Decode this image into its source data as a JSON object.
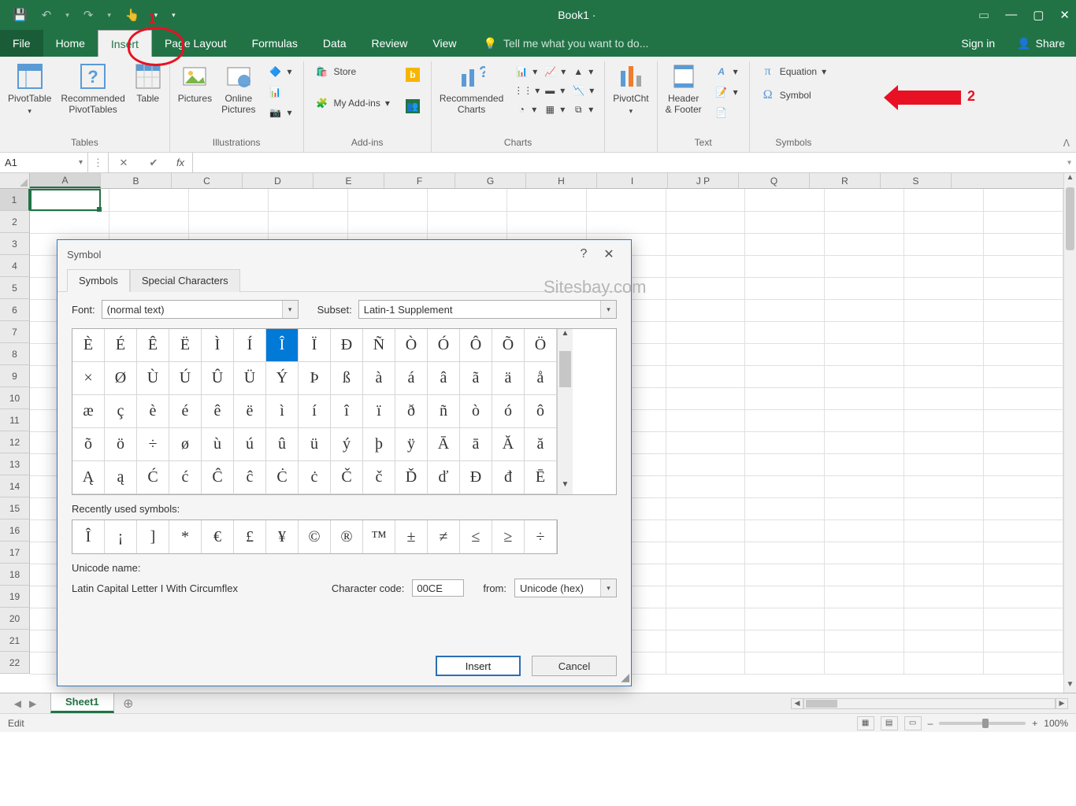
{
  "titlebar": {
    "file": "Book1 · "
  },
  "tabs": [
    "File",
    "Home",
    "Insert",
    "Page Layout",
    "Formulas",
    "Data",
    "Review",
    "View"
  ],
  "active_tab": "Insert",
  "tellme": "Tell me what you want to do...",
  "signin": "Sign in",
  "share": "Share",
  "ribbon": {
    "tables": {
      "label": "Tables",
      "pivot": "PivotTable",
      "rec": "Recommended\nPivotTables",
      "table": "Table"
    },
    "illus": {
      "label": "Illustrations",
      "pics": "Pictures",
      "online": "Online\nPictures"
    },
    "addins": {
      "label": "Add-ins",
      "store": "Store",
      "my": "My Add-ins"
    },
    "reccharts": {
      "label": "Recommended\nCharts"
    },
    "charts_group": "Charts",
    "pivotcht": "PivotCht",
    "text": {
      "label": "Text",
      "hf": "Header\n& Footer"
    },
    "symbols": {
      "label": "Symbols",
      "eq": "Equation",
      "sym": "Symbol"
    }
  },
  "formula_bar": {
    "name": "A1",
    "fx": "fx"
  },
  "columns": [
    "A",
    "B",
    "C",
    "D",
    "E",
    "F",
    "G",
    "H",
    "I",
    "J P",
    "Q",
    "R",
    "S"
  ],
  "rows": [
    "1",
    "2",
    "3",
    "4",
    "5",
    "6",
    "7",
    "8",
    "9",
    "10",
    "11",
    "12",
    "13",
    "14",
    "15",
    "16",
    "17",
    "18",
    "19",
    "20",
    "21",
    "22"
  ],
  "sheettab": "Sheet1",
  "status": "Edit",
  "zoom": "100%",
  "watermark": "Sitesbay.com",
  "annotations": {
    "a1": "1",
    "a2": "2"
  },
  "dialog": {
    "title": "Symbol",
    "tabs": [
      "Symbols",
      "Special Characters"
    ],
    "font_label": "Font:",
    "font": "(normal text)",
    "subset_label": "Subset:",
    "subset": "Latin-1 Supplement",
    "grid": [
      [
        "È",
        "É",
        "Ê",
        "Ë",
        "Ì",
        "Í",
        "Î",
        "Ï",
        "Ð",
        "Ñ",
        "Ò",
        "Ó",
        "Ô",
        "Õ",
        "Ö"
      ],
      [
        "×",
        "Ø",
        "Ù",
        "Ú",
        "Û",
        "Ü",
        "Ý",
        "Þ",
        "ß",
        "à",
        "á",
        "â",
        "ã",
        "ä",
        "å"
      ],
      [
        "æ",
        "ç",
        "è",
        "é",
        "ê",
        "ë",
        "ì",
        "í",
        "î",
        "ï",
        "ð",
        "ñ",
        "ò",
        "ó",
        "ô"
      ],
      [
        "õ",
        "ö",
        "÷",
        "ø",
        "ù",
        "ú",
        "û",
        "ü",
        "ý",
        "þ",
        "ÿ",
        "Ā",
        "ā",
        "Ă",
        "ă"
      ],
      [
        "Ą",
        "ą",
        "Ć",
        "ć",
        "Ĉ",
        "ĉ",
        "Ċ",
        "ċ",
        "Č",
        "č",
        "Ď",
        "ď",
        "Đ",
        "đ",
        "Ē"
      ]
    ],
    "selected": {
      "r": 0,
      "c": 6
    },
    "recent_label": "Recently used symbols:",
    "recent": [
      "Î",
      "¡",
      "]",
      "*",
      "€",
      "£",
      "¥",
      "©",
      "®",
      "™",
      "±",
      "≠",
      "≤",
      "≥",
      "÷"
    ],
    "uniname_label": "Unicode name:",
    "uniname": "Latin Capital Letter I With Circumflex",
    "cc_label": "Character code:",
    "cc": "00CE",
    "from_label": "from:",
    "from": "Unicode (hex)",
    "insert": "Insert",
    "cancel": "Cancel"
  }
}
